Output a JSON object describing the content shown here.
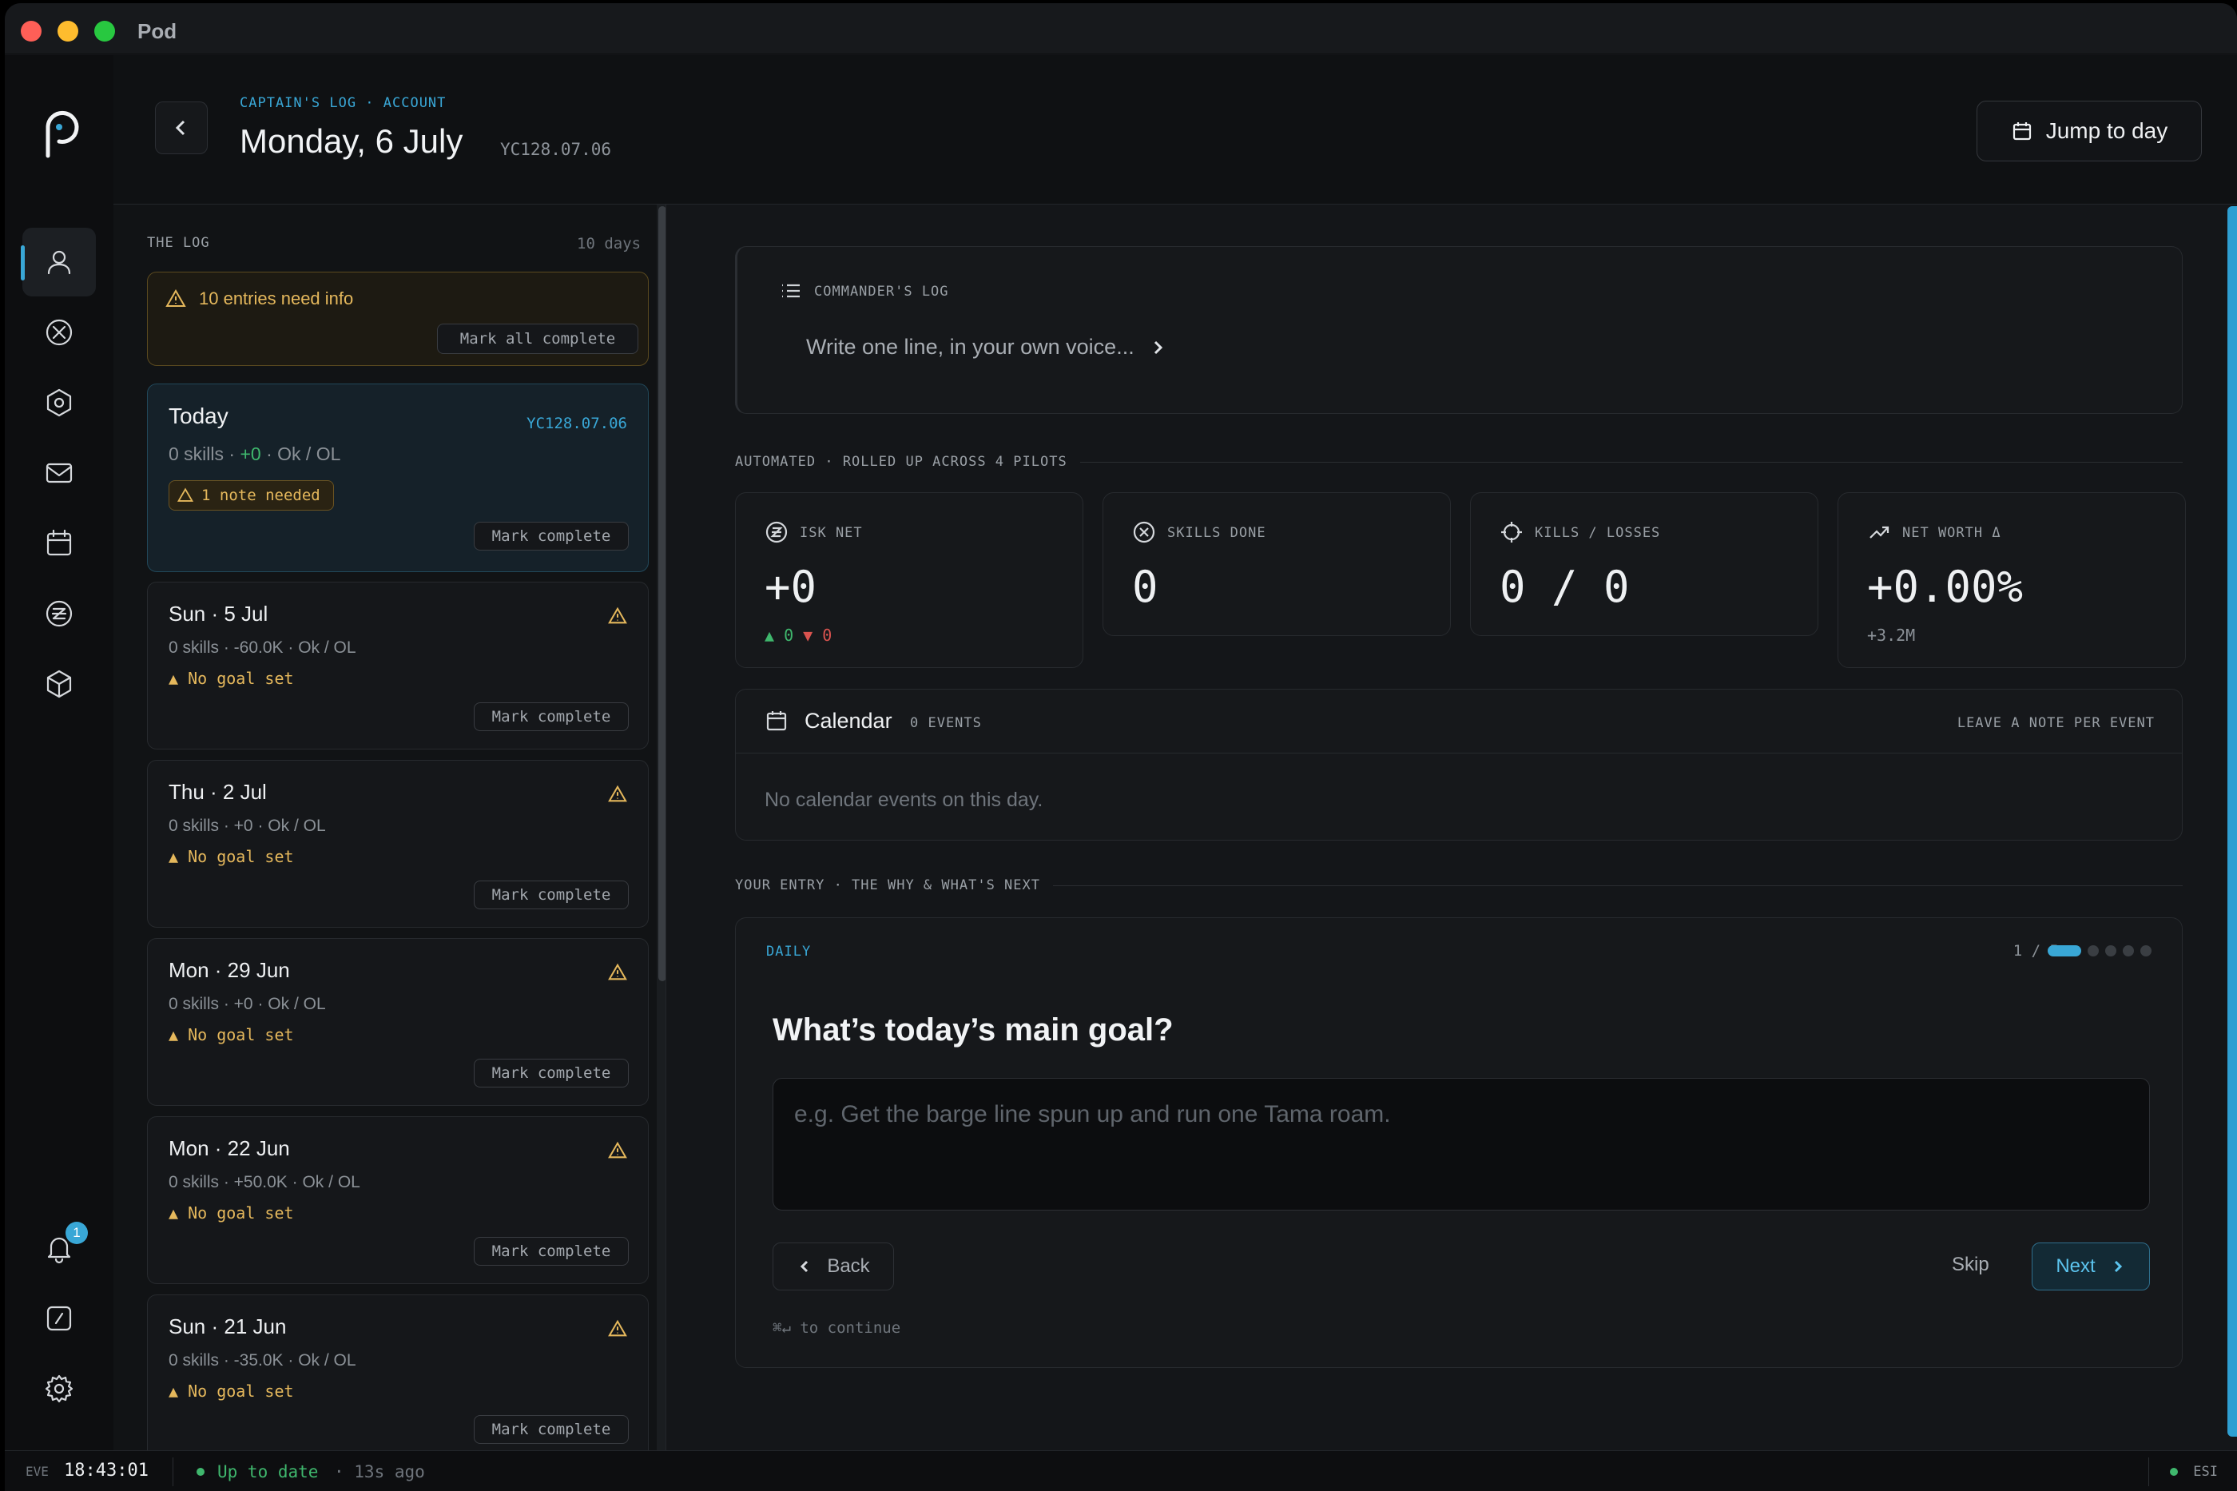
{
  "app": {
    "title": "Pod"
  },
  "header": {
    "breadcrumb": "CAPTAIN'S LOG · ACCOUNT",
    "title": "Monday, 6 July",
    "stamp": "YC128.07.06",
    "jump_label": "Jump to day"
  },
  "rail": {
    "items": [
      "person-icon",
      "skills-icon",
      "hexagon-icon",
      "mail-icon",
      "calendar-icon",
      "isk-icon",
      "cube-icon"
    ],
    "notifications_badge": "1"
  },
  "log": {
    "label": "THE LOG",
    "count": "10 days",
    "warning": "10 entries need info",
    "mark_all": "Mark all complete",
    "mark_complete": "Mark complete",
    "today": {
      "day": "Today",
      "stamp": "YC128.07.06",
      "stats_prefix": "0 skills · ",
      "stats_isk": "+0",
      "stats_suffix": " · Ok / OL",
      "note": "1 note needed"
    },
    "entries": [
      {
        "day": "Sun · 5 Jul",
        "stats": "0 skills · -60.0K · Ok / OL",
        "goal": "No goal set"
      },
      {
        "day": "Thu · 2 Jul",
        "stats": "0 skills · +0 · Ok / OL",
        "goal": "No goal set"
      },
      {
        "day": "Mon · 29 Jun",
        "stats": "0 skills · +0 · Ok / OL",
        "goal": "No goal set"
      },
      {
        "day": "Mon · 22 Jun",
        "stats": "0 skills · +50.0K · Ok / OL",
        "goal": "No goal set"
      },
      {
        "day": "Sun · 21 Jun",
        "stats": "0 skills · -35.0K · Ok / OL",
        "goal": "No goal set"
      }
    ]
  },
  "commander": {
    "label": "COMMANDER'S LOG",
    "prompt": "Write one line, in your own voice..."
  },
  "automated_label": "AUTOMATED · ROLLED UP ACROSS 4 PILOTS",
  "metrics": {
    "isk": {
      "label": "ISK NET",
      "value": "+0",
      "up": "▲ 0",
      "down": "▼ 0"
    },
    "skills": {
      "label": "SKILLS DONE",
      "value": "0"
    },
    "kills": {
      "label": "KILLS / LOSSES",
      "value": "0 / 0"
    },
    "networth": {
      "label": "NET WORTH Δ",
      "value": "+0.00%",
      "sub": "+3.2M"
    }
  },
  "calendar": {
    "title": "Calendar",
    "count": "0 EVENTS",
    "note": "LEAVE A NOTE PER EVENT",
    "empty": "No calendar events on this day."
  },
  "entry_label": "YOUR ENTRY · THE WHY & WHAT'S NEXT",
  "entry": {
    "tag": "DAILY",
    "page": "1 / 5",
    "steps_total": 5,
    "step_current": 1,
    "question": "What’s today’s main goal?",
    "placeholder": "e.g. Get the barge line spun up and run one Tama roam.",
    "back": "Back",
    "skip": "Skip",
    "next": "Next",
    "hint": "⌘↵ to continue"
  },
  "status": {
    "eve_label": "EVE",
    "clock": "18:43:01",
    "sync": "Up to date",
    "ago": "· 13s ago",
    "esi": "ESI"
  },
  "colors": {
    "accent": "#39a7d6",
    "warning": "#e5b85c",
    "positive": "#3fb76d",
    "negative": "#d9534f"
  }
}
